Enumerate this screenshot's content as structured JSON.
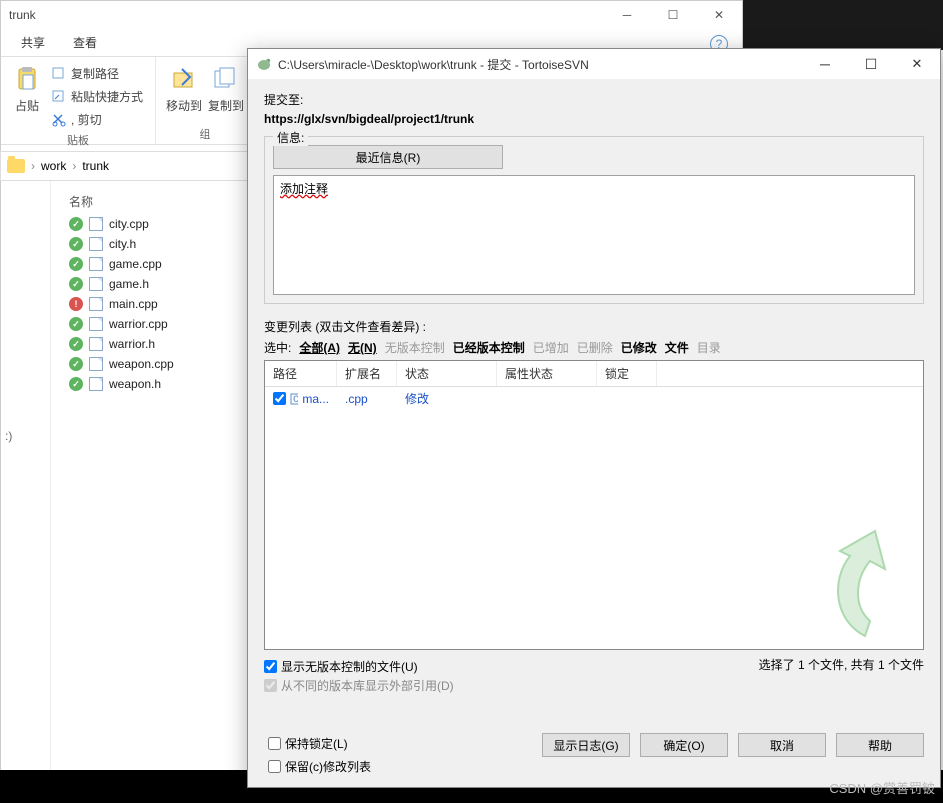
{
  "explorer": {
    "title": "trunk",
    "tabs": {
      "share": "共享",
      "view": "查看"
    },
    "ribbon": {
      "paste": "占贴",
      "cut": ", 剪切",
      "copy_path": "复制路径",
      "paste_shortcut": "粘贴快捷方式",
      "clipboard_group": "贴板",
      "move_to": "移动到",
      "copy_to": "复制到",
      "organize_group": "组"
    },
    "breadcrumb": {
      "work": "work",
      "trunk": "trunk"
    },
    "list_header": "名称",
    "files": [
      {
        "name": "city.cpp",
        "status": "ok"
      },
      {
        "name": "city.h",
        "status": "ok"
      },
      {
        "name": "game.cpp",
        "status": "ok"
      },
      {
        "name": "game.h",
        "status": "ok"
      },
      {
        "name": "main.cpp",
        "status": "mod"
      },
      {
        "name": "warrior.cpp",
        "status": "ok"
      },
      {
        "name": "warrior.h",
        "status": "ok"
      },
      {
        "name": "weapon.cpp",
        "status": "ok"
      },
      {
        "name": "weapon.h",
        "status": "ok"
      }
    ],
    "tree_marker": ":)"
  },
  "dialog": {
    "title": "C:\\Users\\miracle-\\Desktop\\work\\trunk - 提交 - TortoiseSVN",
    "commit_to_label": "提交至:",
    "url": "https://glx/svn/bigdeal/project1/trunk",
    "message_group": "信息:",
    "recent_btn": "最近信息(R)",
    "message_text": "添加注释",
    "changelist_label": "变更列表  (双击文件查看差异) :",
    "filter": {
      "select": "选中:",
      "all": "全部(A)",
      "none": "无(N)",
      "unversioned": "无版本控制",
      "versioned": "已经版本控制",
      "added": "已增加",
      "deleted": "已删除",
      "modified": "已修改",
      "files": "文件",
      "dirs": "目录"
    },
    "table": {
      "col_path": "路径",
      "col_ext": "扩展名",
      "col_status": "状态",
      "col_propstatus": "属性状态",
      "col_lock": "锁定",
      "row": {
        "path": "ma...",
        "ext": ".cpp",
        "status": "修改"
      }
    },
    "show_unversioned": "显示无版本控制的文件(U)",
    "show_externals": "从不同的版本库显示外部引用(D)",
    "selection_status": "选择了 1 个文件, 共有 1 个文件",
    "keep_locks": "保持锁定(L)",
    "keep_changelist": "保留(c)修改列表",
    "btn_showlog": "显示日志(G)",
    "btn_ok": "确定(O)",
    "btn_cancel": "取消",
    "btn_help": "帮助"
  },
  "watermark": "CSDN @赏善罚铍"
}
